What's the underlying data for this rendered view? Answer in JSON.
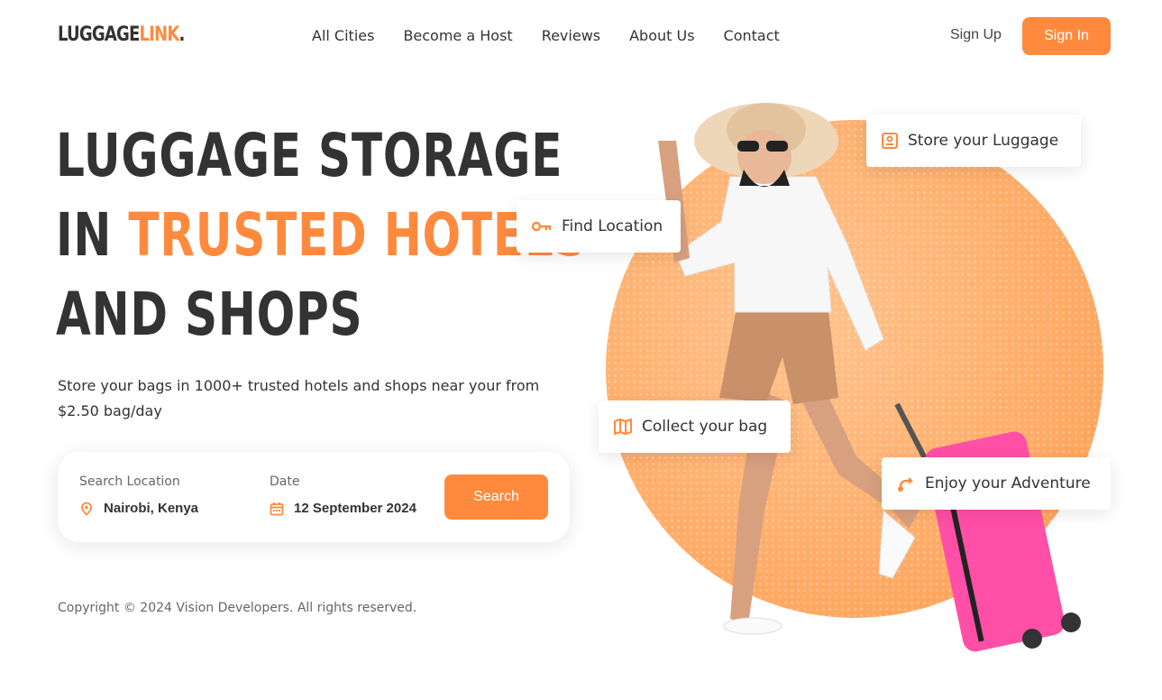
{
  "brand": {
    "part1": "LUGGAGE",
    "part2": "LINK",
    "part3": "."
  },
  "nav": {
    "items": [
      "All Cities",
      "Become a Host",
      "Reviews",
      "About Us",
      "Contact"
    ]
  },
  "auth": {
    "signup": "Sign Up",
    "signin": "Sign In"
  },
  "hero": {
    "line1": "LUGGAGE STORAGE",
    "line2_prefix": "IN ",
    "line2_accent": "TRUSTED HOTELS",
    "line3": "AND SHOPS",
    "subtitle": "Store your bags in 1000+ trusted hotels and shops near your from $2.50 bag/day"
  },
  "search": {
    "location_label": "Search Location",
    "location_value": "Nairobi, Kenya",
    "date_label": "Date",
    "date_value": "12 September 2024",
    "button": "Search"
  },
  "features": {
    "store": "Store your Luggage",
    "find": "Find Location",
    "collect": "Collect your bag",
    "enjoy": "Enjoy your Adventure"
  },
  "footer": {
    "copyright": "Copyright © 2024 Vision Developers. All rights reserved."
  },
  "colors": {
    "accent": "#ff8a3d",
    "text": "#333333"
  }
}
